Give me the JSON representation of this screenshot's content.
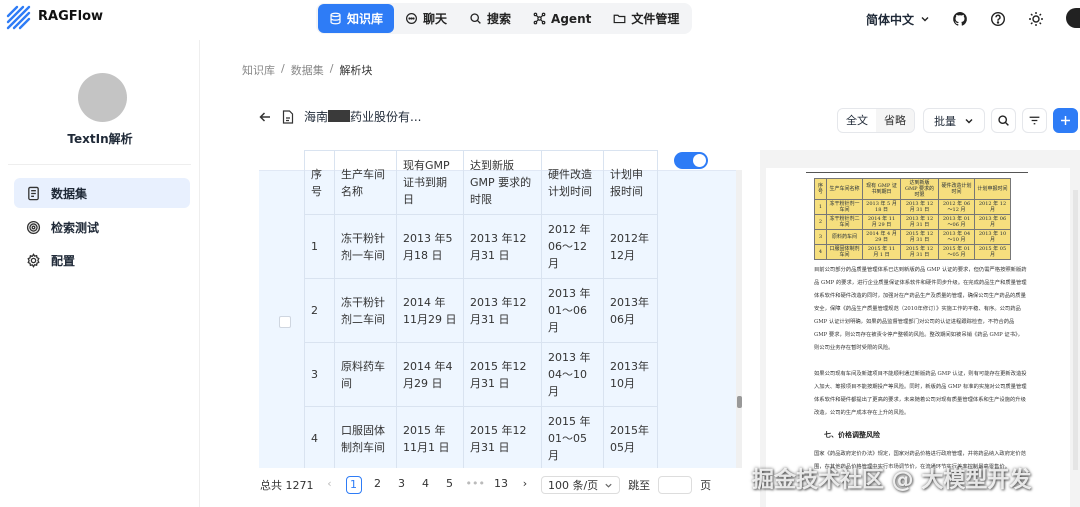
{
  "app": {
    "name": "RAGFlow"
  },
  "nav": {
    "items": [
      {
        "label": "知识库",
        "active": true
      },
      {
        "label": "聊天",
        "active": false
      },
      {
        "label": "搜索",
        "active": false
      },
      {
        "label": "Agent",
        "active": false
      },
      {
        "label": "文件管理",
        "active": false
      }
    ]
  },
  "header": {
    "language": "简体中文"
  },
  "sidebar": {
    "kb_name": "TextIn解析",
    "items": [
      {
        "label": "数据集",
        "active": true
      },
      {
        "label": "检索测试",
        "active": false
      },
      {
        "label": "配置",
        "active": false
      }
    ]
  },
  "breadcrumb": [
    "知识库",
    "数据集",
    "解析块"
  ],
  "document": {
    "name_prefix": "海南",
    "name_suffix": "药业股份有..."
  },
  "toolbar": {
    "full_text": "全文",
    "ellipsis": "省略",
    "batch": "批量"
  },
  "chunk_table": {
    "header": [
      "序号",
      "生产车间名称",
      "现有GMP证书到期日",
      "达到新版GMP 要求的时限",
      "硬件改造计划时间",
      "计划申报时间"
    ],
    "rows": [
      [
        "1",
        "冻干粉针剂一车间",
        "2013 年5月18 日",
        "2013 年12月31 日",
        "2012 年06～12月",
        "2012年12月"
      ],
      [
        "2",
        "冻干粉针剂二车间",
        "2014 年11月29 日",
        "2013 年12月31 日",
        "2013 年01～06月",
        "2013年06月"
      ],
      [
        "3",
        "原料药车间",
        "2014 年4月29 日",
        "2015 年12月31 日",
        "2013 年04～10月",
        "2013年10月"
      ],
      [
        "4",
        "口服固体制剂车间",
        "2015 年11月1 日",
        "2015 年12月31 日",
        "2015 年01～05月",
        "2015年05月"
      ]
    ]
  },
  "pagination": {
    "total": "总共 1271",
    "pages": [
      "1",
      "2",
      "3",
      "4",
      "5",
      "•••",
      "13"
    ],
    "current": "1",
    "page_size": "100 条/页",
    "jump_label": "跳至",
    "page_unit": "页"
  },
  "preview": {
    "table": {
      "header": [
        "序号",
        "生产车间名称",
        "现有 GMP 证书到期日",
        "达到新版 GMP 要求的时限",
        "硬件改造计划时间",
        "计划申报时间"
      ],
      "rows": [
        [
          "1",
          "冻干粉针剂一车间",
          "2013 年 5 月 18 日",
          "2013 年 12 月 31 日",
          "2012 年 06～12 月",
          "2012 年 12 月"
        ],
        [
          "2",
          "冻干粉针剂二车间",
          "2014 年 11 月 29 日",
          "2013 年 12 月 31 日",
          "2013 年 01～06 月",
          "2013 年 06 月"
        ],
        [
          "3",
          "原料药车间",
          "2014 年 4 月 29 日",
          "2015 年 12 月 31 日",
          "2013 年 04～10 月",
          "2013 年 10 月"
        ],
        [
          "4",
          "口服固体制剂车间",
          "2015 年 11 月 1 日",
          "2015 年 12 月 31 日",
          "2015 年 01～05 月",
          "2015 年 05 月"
        ]
      ]
    },
    "para1": "目前公司部分药品质量管理体系已达到新版药品 GMP 认证的要求，但仍需严格按照新版药品 GMP 的要求，进行企业质量保证体系软件和硬件同步升级。在完成药品生产和质量管理体系软件和硬件改造的同时，加强对在产药品生产及质量的管理，确保公司生产药品的质量安全，保障《药品生产质量管理规范（2010年修订）》实施工作的平稳、有序。公司药品 GMP 认证计划明确，如果药品监督管理部门对公司的认证进程跟踪检查，不符合药品 GMP 要求，则公司存在被责令停产整顿的风险。整改期间如被吊销《药品 GMP 证书》，则公司业务存在暂时受限的风险。",
    "para2": "如果公司现有车间及新建项目不能顺利通过新版药品 GMP 认证，则有可能存在更新改造投入加大、筹报项目不能按期投产等风险。同时，新版药品 GMP 标准的实施对公司质量管理体系软件和硬件都提出了更高的要求，未来随着公司对现有质量管理体系和生产设施的升级改造，公司的生产成本存在上升的风险。",
    "section": "七、价格调整风险",
    "para3": "国家《药品政府定价办法》规定，国家对药品价格进行政府管理，并将药品纳入政府定价范围，在其他药品价格管理中实行市场调节价，在流通环节实行差率控制最高零售价。"
  },
  "watermark": "掘金技术社区 @ 大模型开发"
}
